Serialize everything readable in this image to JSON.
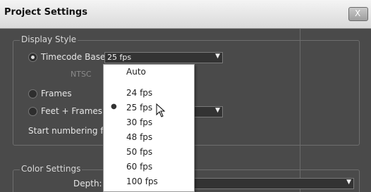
{
  "window": {
    "title": "Project Settings",
    "close_label": "X"
  },
  "display_style": {
    "legend": "Display Style",
    "timecode_base_label": "Timecode Base:",
    "timecode_base_value": "25 fps",
    "hidden_sub_label": "NTSC",
    "frames_label": "Frames",
    "feet_frames_label": "Feet + Frames:",
    "start_numbering_label": "Start numbering fram"
  },
  "color_settings": {
    "legend": "Color Settings",
    "depth_label": "Depth:"
  },
  "dropdown": {
    "selected_index": 2,
    "options": [
      "Auto",
      "24 fps",
      "25 fps",
      "30 fps",
      "48 fps",
      "50 fps",
      "60 fps",
      "100 fps"
    ]
  }
}
